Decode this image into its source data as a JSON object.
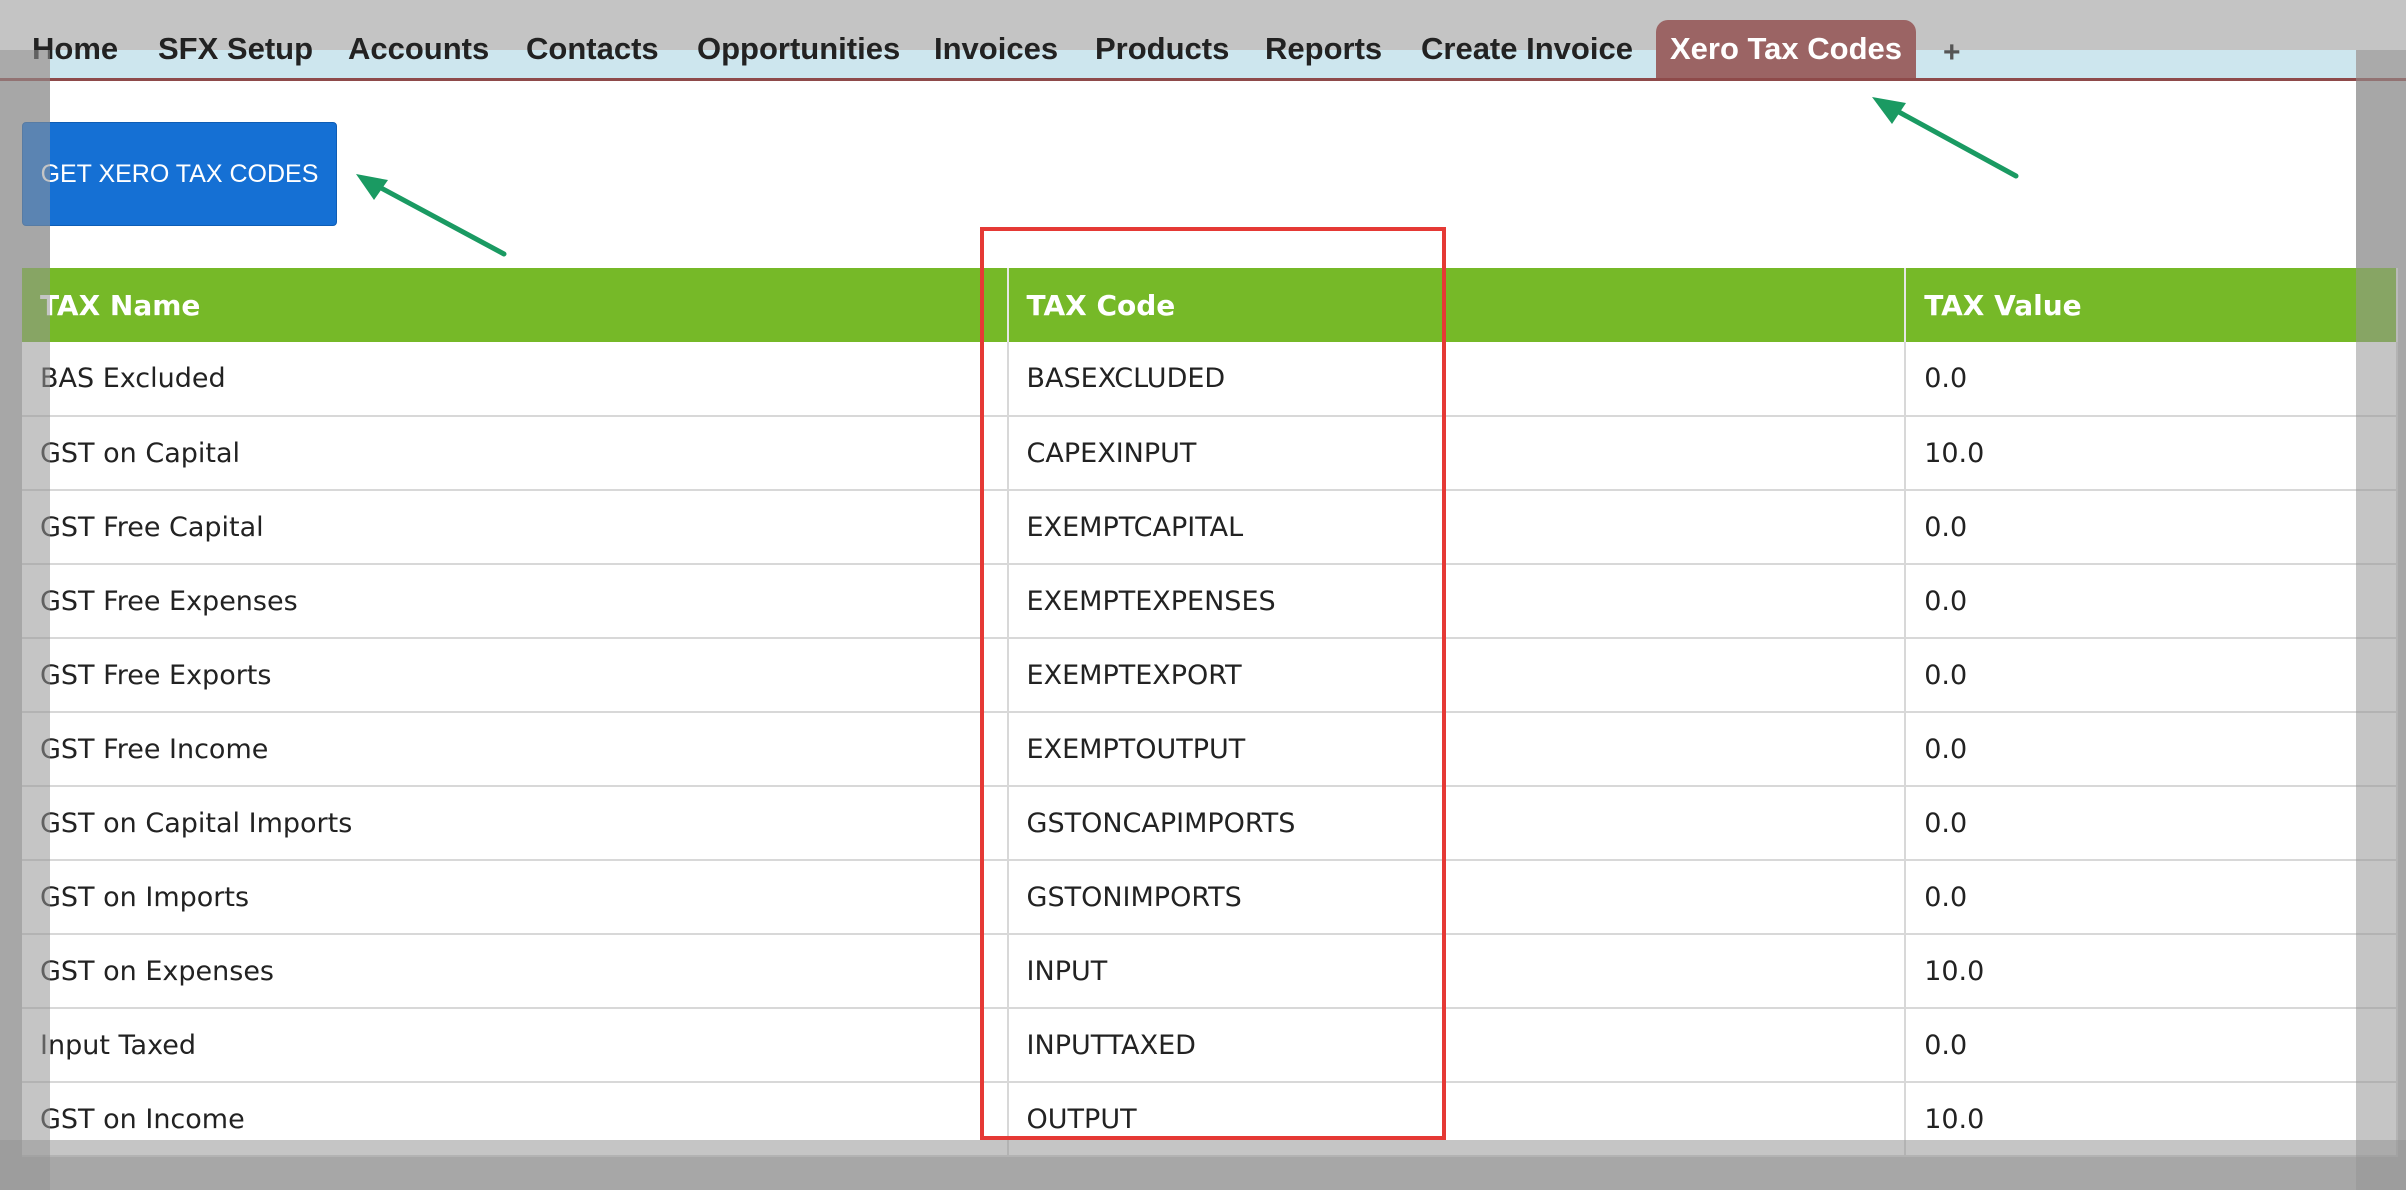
{
  "nav": {
    "items": [
      {
        "label": "Home"
      },
      {
        "label": "SFX Setup"
      },
      {
        "label": "Accounts"
      },
      {
        "label": "Contacts"
      },
      {
        "label": "Opportunities"
      },
      {
        "label": "Invoices"
      },
      {
        "label": "Products"
      },
      {
        "label": "Reports"
      },
      {
        "label": "Create Invoice"
      },
      {
        "label": "Xero Tax Codes"
      }
    ],
    "active": "Xero Tax Codes",
    "add_label": "+"
  },
  "button": {
    "label": "GET XERO TAX CODES"
  },
  "table": {
    "headers": [
      "TAX Name",
      "TAX Code",
      "TAX Value"
    ],
    "rows": [
      [
        "BAS Excluded",
        "BASEXCLUDED",
        "0.0"
      ],
      [
        "GST on Capital",
        "CAPEXINPUT",
        "10.0"
      ],
      [
        "GST Free Capital",
        "EXEMPTCAPITAL",
        "0.0"
      ],
      [
        "GST Free Expenses",
        "EXEMPTEXPENSES",
        "0.0"
      ],
      [
        "GST Free Exports",
        "EXEMPTEXPORT",
        "0.0"
      ],
      [
        "GST Free Income",
        "EXEMPTOUTPUT",
        "0.0"
      ],
      [
        "GST on Capital Imports",
        "GSTONCAPIMPORTS",
        "0.0"
      ],
      [
        "GST on Imports",
        "GSTONIMPORTS",
        "0.0"
      ],
      [
        "GST on Expenses",
        "INPUT",
        "10.0"
      ],
      [
        "Input Taxed",
        "INPUTTAXED",
        "0.0"
      ],
      [
        "GST on Income",
        "OUTPUT",
        "10.0"
      ]
    ]
  },
  "colors": {
    "header_green": "#76b928",
    "button_blue": "#1570d4",
    "active_tab": "#9b6464",
    "annotation_red": "#e53935",
    "annotation_arrow": "#1a9a62"
  }
}
